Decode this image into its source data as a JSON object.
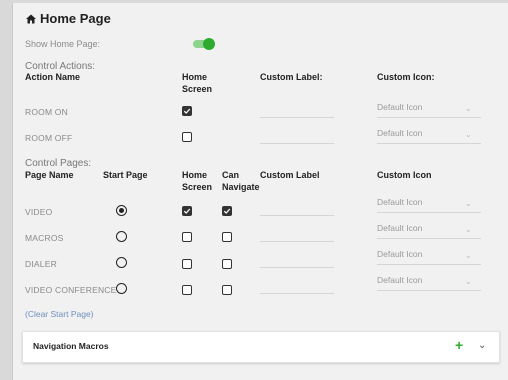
{
  "page": {
    "title": "Home Page",
    "show_home_page_label": "Show Home Page:",
    "show_home_page": true
  },
  "control_actions": {
    "section_label": "Control Actions:",
    "headers": {
      "action_name": "Action Name",
      "home_screen": "Home\nScreen",
      "custom_label": "Custom Label:",
      "custom_icon": "Custom Icon:"
    },
    "rows": [
      {
        "name": "ROOM ON",
        "home_screen": true,
        "custom_label": "",
        "icon": "Default Icon"
      },
      {
        "name": "ROOM OFF",
        "home_screen": false,
        "custom_label": "",
        "icon": "Default Icon"
      }
    ]
  },
  "control_pages": {
    "section_label": "Control Pages:",
    "headers": {
      "page_name": "Page Name",
      "start_page": "Start Page",
      "home_screen": "Home\nScreen",
      "can_navigate": "Can\nNavigate",
      "custom_label": "Custom Label",
      "custom_icon": "Custom Icon"
    },
    "rows": [
      {
        "name": "VIDEO",
        "start_page": true,
        "home_screen": true,
        "can_navigate": true,
        "icon": "Default Icon"
      },
      {
        "name": "MACROS",
        "start_page": false,
        "home_screen": false,
        "can_navigate": false,
        "icon": "Default Icon"
      },
      {
        "name": "DIALER",
        "start_page": false,
        "home_screen": false,
        "can_navigate": false,
        "icon": "Default Icon"
      },
      {
        "name": "VIDEO CONFERENCE",
        "start_page": false,
        "home_screen": false,
        "can_navigate": false,
        "icon": "Default Icon"
      }
    ],
    "clear_start_page": "(Clear Start Page)"
  },
  "navigation_macros": {
    "title": "Navigation Macros",
    "add_icon": "plus-icon",
    "expand_icon": "chevron-down-icon"
  },
  "colors": {
    "accent_green": "#2eaa2e",
    "link_blue": "#6f8fbf"
  }
}
